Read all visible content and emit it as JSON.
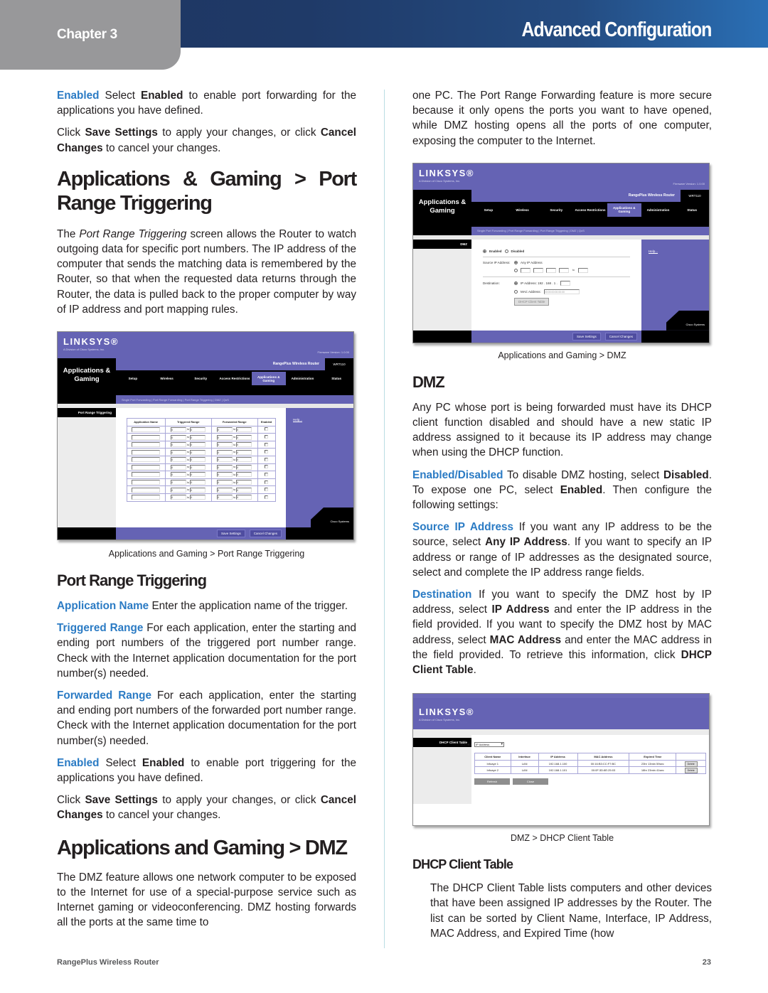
{
  "header": {
    "chapter": "Chapter 3",
    "title": "Advanced Configuration"
  },
  "left": {
    "p1": {
      "term": "Enabled",
      "t1": " Select ",
      "b1": "Enabled",
      "t2": " to enable port forwarding for the applications you have defined."
    },
    "p2": {
      "t1": "Click ",
      "b1": "Save Settings",
      "t2": " to apply your changes, or click ",
      "b2": "Cancel Changes",
      "t3": " to cancel your changes."
    },
    "heading1": "Applications & Gaming > Port Range Triggering",
    "p3": {
      "t1": "The ",
      "i1": "Port Range Triggering",
      "t2": " screen allows the Router to watch outgoing data for specific port numbers. The IP address of the computer that sends the matching data is remembered by the Router, so that when the requested data returns through the Router, the data is pulled back to the proper computer by way of IP address and port mapping rules."
    },
    "figure1": {
      "caption": "Applications and Gaming > Port Range Triggering",
      "logo": "LINKSYS®",
      "logo_sub": "A Division of Cisco Systems, Inc.",
      "firmware": "Firmware Version: 1.0.00",
      "section": "Applications & Gaming",
      "product": "RangePlus Wireless Router",
      "model": "WRT110",
      "tabs": [
        "Setup",
        "Wireless",
        "Security",
        "Access Restrictions",
        "Applications & Gaming",
        "Administration",
        "Status"
      ],
      "active_tab": "Applications & Gaming",
      "subtabs": "Single Port Forwarding  |  Port Range Forwarding  |  Port Range Triggering  |  DMZ  |  QoS",
      "left_label": "Port Range Triggering",
      "columns": [
        "Application Name",
        "Triggered Range",
        "Forwarded Range",
        "Enabled"
      ],
      "rows": [
        {
          "name": "",
          "t_start": "0",
          "t_end": "0",
          "f_start": "0",
          "f_end": "0",
          "enabled": false
        },
        {
          "name": "",
          "t_start": "0",
          "t_end": "0",
          "f_start": "0",
          "f_end": "0",
          "enabled": false
        },
        {
          "name": "",
          "t_start": "0",
          "t_end": "0",
          "f_start": "0",
          "f_end": "0",
          "enabled": false
        },
        {
          "name": "",
          "t_start": "0",
          "t_end": "0",
          "f_start": "0",
          "f_end": "0",
          "enabled": false
        },
        {
          "name": "",
          "t_start": "0",
          "t_end": "0",
          "f_start": "0",
          "f_end": "0",
          "enabled": false
        },
        {
          "name": "",
          "t_start": "0",
          "t_end": "0",
          "f_start": "0",
          "f_end": "0",
          "enabled": false
        },
        {
          "name": "",
          "t_start": "0",
          "t_end": "0",
          "f_start": "0",
          "f_end": "0",
          "enabled": false
        },
        {
          "name": "",
          "t_start": "0",
          "t_end": "0",
          "f_start": "0",
          "f_end": "0",
          "enabled": false
        },
        {
          "name": "",
          "t_start": "0",
          "t_end": "0",
          "f_start": "0",
          "f_end": "0",
          "enabled": false
        },
        {
          "name": "",
          "t_start": "0",
          "t_end": "0",
          "f_start": "0",
          "f_end": "0",
          "enabled": false
        }
      ],
      "to_label": "to",
      "help": "Help...",
      "cisco": "Cisco Systems",
      "save": "Save Settings",
      "cancel": "Cancel Changes"
    },
    "heading2": "Port Range Triggering",
    "p4": {
      "term": "Application Name",
      "text": " Enter the application name of the trigger."
    },
    "p5": {
      "term": "Triggered Range",
      "text": " For each application, enter the starting and ending port numbers of the triggered port number range. Check with the Internet application documentation for the port number(s) needed."
    },
    "p6": {
      "term": "Forwarded Range",
      "text": " For each application, enter the starting and ending port numbers of the forwarded port number range. Check with the Internet application documentation for the port number(s) needed."
    },
    "p7": {
      "term": "Enabled",
      "t1": " Select ",
      "b1": "Enabled",
      "t2": " to enable port triggering for the applications you have defined."
    },
    "p8": {
      "t1": "Click ",
      "b1": "Save Settings",
      "t2": " to apply your changes, or click ",
      "b2": "Cancel Changes",
      "t3": " to cancel your changes."
    },
    "heading3": "Applications and Gaming > DMZ",
    "p9": "The DMZ feature allows one network computer to be exposed to the Internet for use of a special-purpose service such as Internet gaming or videoconferencing. DMZ hosting forwards all the ports at the same time to"
  },
  "right": {
    "p1": "one PC. The Port Range Forwarding feature is more secure because it only opens the ports you want to have opened, while DMZ hosting opens all the ports of one computer, exposing the computer to the Internet.",
    "figure2": {
      "caption": "Applications and Gaming > DMZ",
      "left_label": "DMZ",
      "enabled": "Enabled",
      "disabled": "Disabled",
      "source_label": "Source IP Address:",
      "any_ip": "Any IP Address",
      "range_fields": [
        "0",
        "0",
        "0",
        "0",
        "0"
      ],
      "dest_label": "Destination:",
      "ip_label": "IP Address: 192 . 168 . 1 .",
      "ip_last": "0",
      "mac_label": "MAC Address:",
      "mac_value": "00:00:00:00:00:00",
      "dhcp_btn": "DHCP Client Table",
      "help": "Help...",
      "save": "Save Settings",
      "cancel": "Cancel Changes"
    },
    "heading1": "DMZ",
    "p2": "Any PC whose port is being forwarded must have its DHCP client function disabled and should have a new static IP address assigned to it because its IP address may change when using the DHCP function.",
    "p3": {
      "term": "Enabled/Disabled",
      "t1": " To disable DMZ hosting, select ",
      "b1": "Disabled",
      "t2": ". To expose one PC, select ",
      "b2": "Enabled",
      "t3": ". Then configure the following settings:"
    },
    "p4": {
      "term": "Source IP Address",
      "t1": " If you want any IP address to be the source, select ",
      "b1": "Any IP Address",
      "t2": ". If you want to specify an IP address or range of IP addresses as the designated source, select and complete the IP address range fields."
    },
    "p5": {
      "term": "Destination",
      "t1": " If you want to specify the DMZ host by IP address, select ",
      "b1": "IP Address",
      "t2": " and enter the IP address in the field provided. If you want to specify the DMZ host by MAC address, select ",
      "b2": "MAC Address",
      "t3": " and enter the MAC address in the field provided. To retrieve this information, click ",
      "b3": "DHCP Client Table",
      "t4": "."
    },
    "figure3": {
      "caption": "DMZ > DHCP Client Table",
      "left_label": "DHCP Client Table",
      "sort_label": "Sort By",
      "sort_value": "IP Address",
      "columns": [
        "Client Name",
        "Interface",
        "IP Address",
        "MAC Address",
        "Expired Time",
        ""
      ],
      "rows": [
        {
          "name": "Infoaye 1",
          "iface": "LAN",
          "ip": "192.168.1.100",
          "mac": "00:16:B3:CC:F7:BC",
          "expires": "23hr 13min 59sec",
          "action": "Delete"
        },
        {
          "name": "Infoaye 2",
          "iface": "LAN",
          "ip": "192.168.1.101",
          "mac": "00:0F:3D:8E:25:03",
          "expires": "18hr 23min 41sec",
          "action": "Delete"
        }
      ],
      "refresh": "Refresh",
      "close": "Close"
    },
    "heading2": "DHCP Client Table",
    "p6": "The DHCP Client Table lists computers and other devices that have been assigned IP addresses by the Router. The list can be sorted by Client Name, Interface, IP Address, MAC Address, and Expired Time (how"
  },
  "footer": {
    "product": "RangePlus Wireless Router",
    "page": "23"
  }
}
